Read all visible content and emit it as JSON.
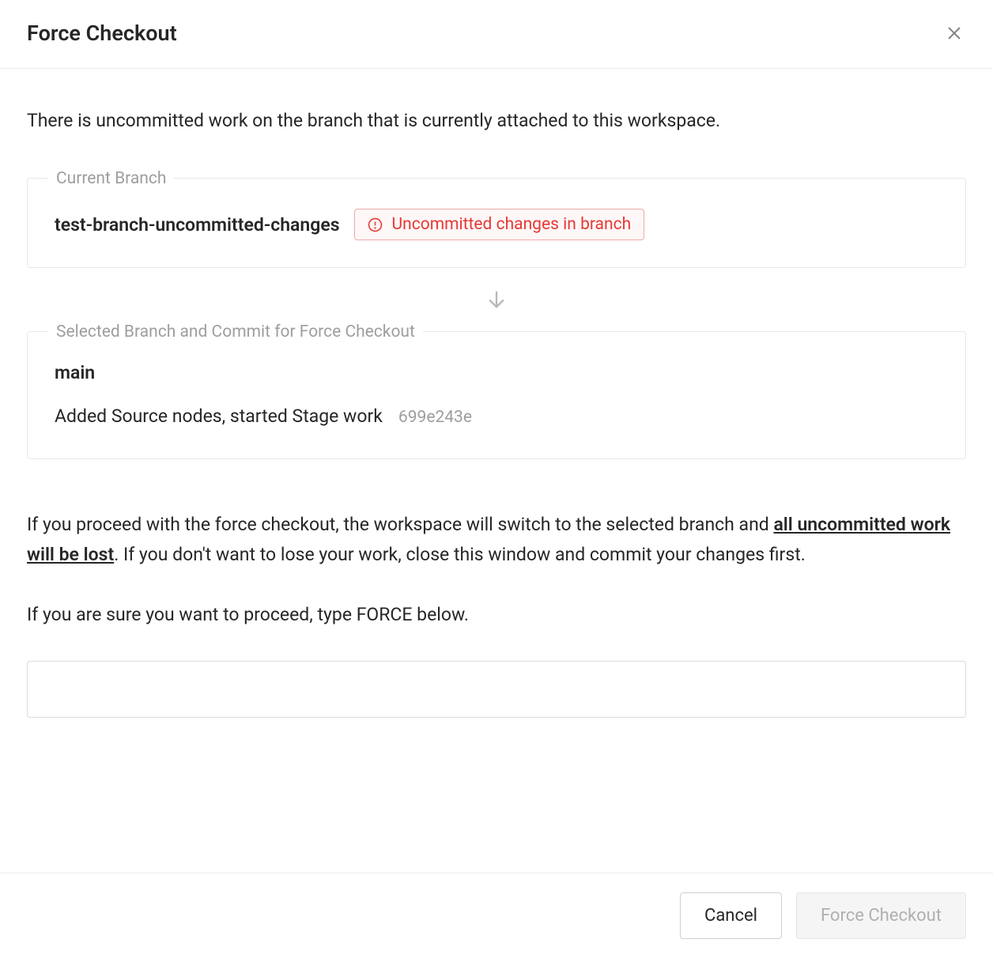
{
  "dialog": {
    "title": "Force Checkout",
    "intro": "There is uncommitted work on the branch that is currently attached to this workspace."
  },
  "current_branch": {
    "legend": "Current Branch",
    "name": "test-branch-uncommitted-changes",
    "badge_text": "Uncommitted changes in branch"
  },
  "selected": {
    "legend": "Selected Branch and Commit for Force Checkout",
    "branch": "main",
    "commit_message": "Added Source nodes, started Stage work",
    "commit_hash": "699e243e"
  },
  "warning": {
    "part1": "If you proceed with the force checkout, the workspace will switch to the selected branch and ",
    "emphasis": "all uncommitted work will be lost",
    "part2": ". If you don't want to lose your work, close this window and commit your changes first."
  },
  "confirm": {
    "instruction": "If you are sure you want to proceed, type FORCE below.",
    "input_value": ""
  },
  "footer": {
    "cancel": "Cancel",
    "confirm": "Force Checkout"
  }
}
